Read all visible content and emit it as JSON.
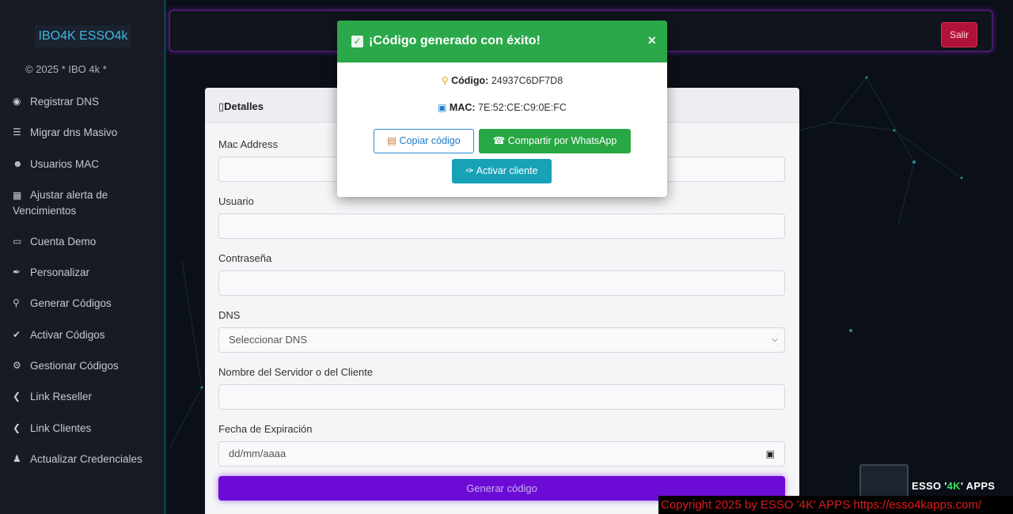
{
  "colors": {
    "sidebar_bg": "#161b24",
    "brand_text": "#3fb9df",
    "modal_success": "#2aa84a",
    "logout": "#b0123a",
    "submit": "#6c0bd6",
    "activate": "#17a2b8",
    "copyright": "#e0191f"
  },
  "sidebar": {
    "brand": "IBO4K ESSO4k",
    "copyright": "© 2025 * IBO 4k *",
    "items": [
      {
        "label": "Registrar DNS",
        "icon": "globe-icon"
      },
      {
        "label": "Migrar dns Masivo",
        "icon": "list-icon"
      },
      {
        "label": "Usuarios MAC",
        "icon": "users-icon"
      },
      {
        "label": "Ajustar alerta de Vencimientos",
        "icon": "calendar-icon"
      },
      {
        "label": "Cuenta Demo",
        "icon": "monitor-icon"
      },
      {
        "label": "Personalizar",
        "icon": "brush-icon"
      },
      {
        "label": "Generar Códigos",
        "icon": "key-icon"
      },
      {
        "label": "Activar Códigos",
        "icon": "check-circle-icon"
      },
      {
        "label": "Gestionar Códigos",
        "icon": "gears-icon"
      },
      {
        "label": "Link Reseller",
        "icon": "share-icon"
      },
      {
        "label": "Link Clientes",
        "icon": "share-icon"
      },
      {
        "label": "Actualizar Credenciales",
        "icon": "user-icon"
      }
    ]
  },
  "topbar": {
    "logout_label": "Salir"
  },
  "card": {
    "header": "Detalles",
    "fields": {
      "mac_label": "Mac Address",
      "mac_value": "",
      "user_label": "Usuario",
      "user_value": "",
      "password_label": "Contraseña",
      "password_value": "",
      "dns_label": "DNS",
      "dns_selected": "Seleccionar DNS",
      "server_label": "Nombre del Servidor o del Cliente",
      "server_value": "",
      "expiry_label": "Fecha de Expiración",
      "expiry_placeholder": "dd/mm/aaaa"
    },
    "submit_label": "Generar código"
  },
  "modal": {
    "title": "¡Código generado con éxito!",
    "code_label": "Código:",
    "code_value": "24937C6DF7D8",
    "mac_label": "MAC:",
    "mac_value": "7E:52:CE:C9:0E:FC",
    "copy_label": "Copiar código",
    "whatsapp_label": "Compartir por WhatsApp",
    "activate_label": "Activar cliente"
  },
  "branding": {
    "title_pre": "ESSO '",
    "title_accent": "4K",
    "title_post": "' APPS",
    "copyright": "Copyright 2025  by ESSO '4K' APPS https://esso4kapps.com/"
  }
}
